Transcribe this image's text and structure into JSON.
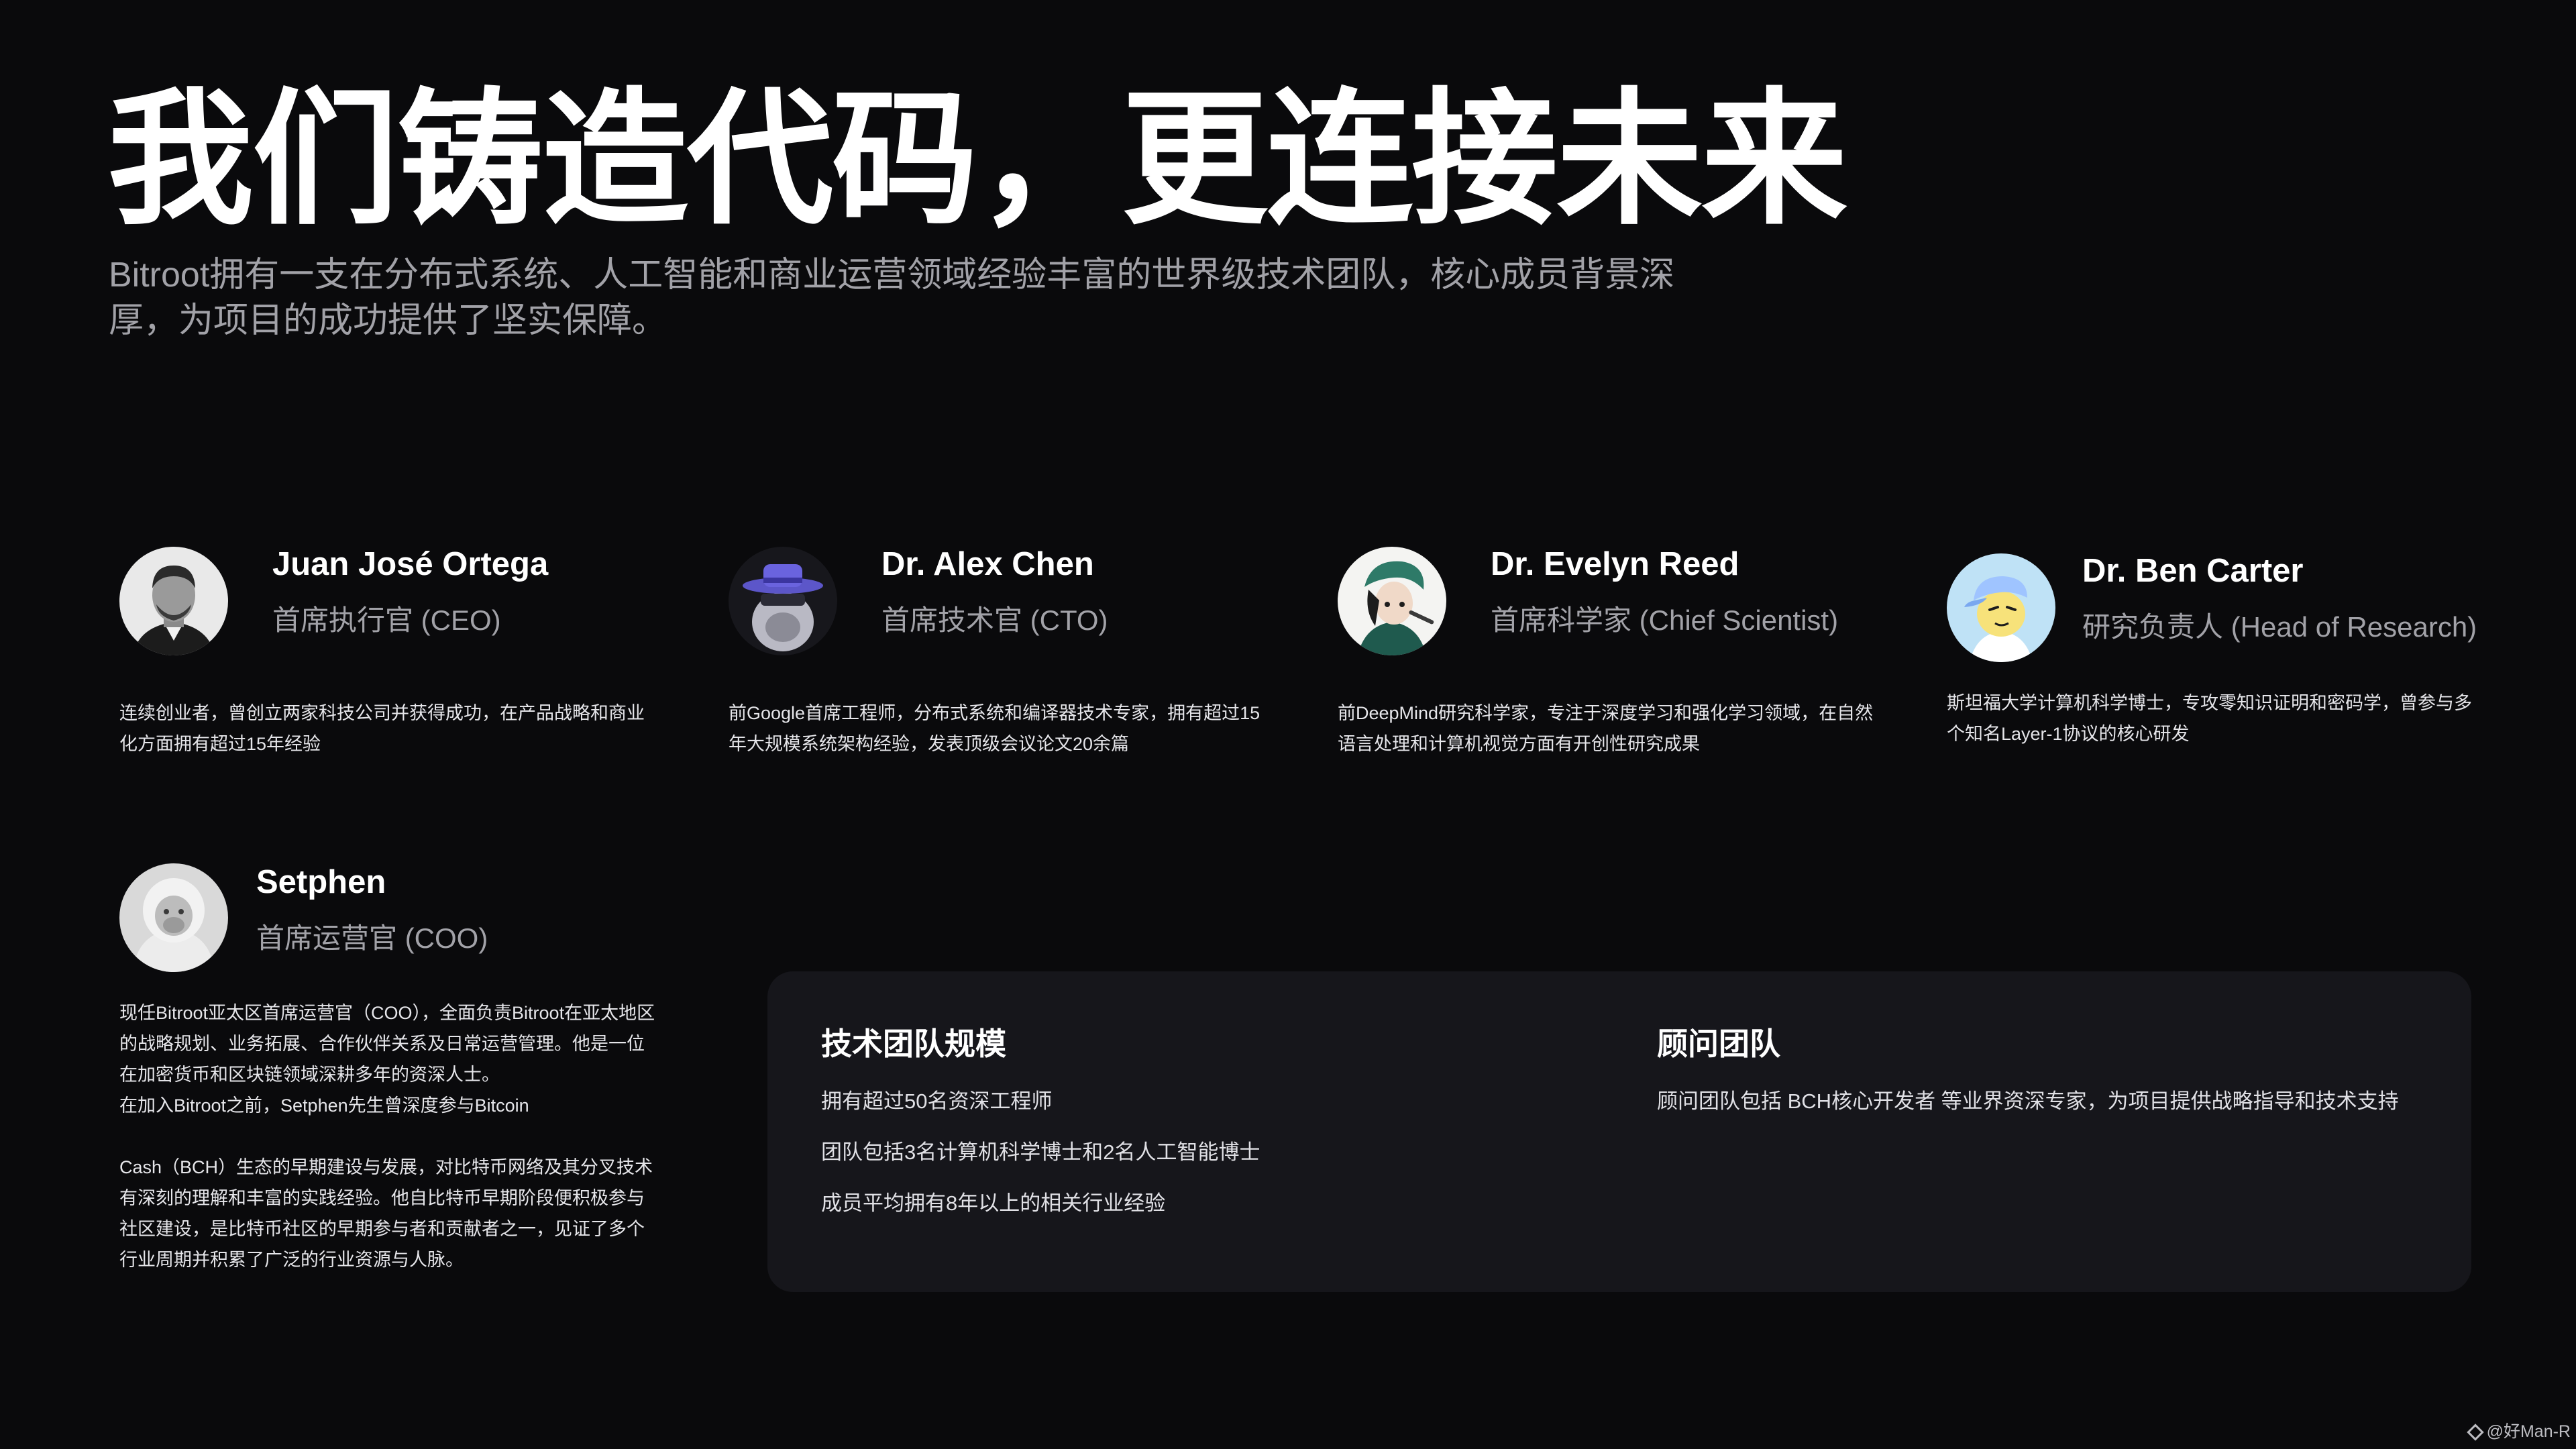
{
  "hero": {
    "title": "我们铸造代码，更连接未来",
    "subtitle": "Bitroot拥有一支在分布式系统、人工智能和商业运营领域经验丰富的世界级技术团队，核心成员背景深厚，为项目的成功提供了坚实保障。"
  },
  "team": [
    {
      "name": "Juan José Ortega",
      "role": "首席执行官 (CEO)",
      "bio": "连续创业者，曾创立两家科技公司并获得成功，在产品战略和商业化方面拥有超过15年经验",
      "avatar": "photo-portrait-man"
    },
    {
      "name": "Dr. Alex Chen",
      "role": "首席技术官 (CTO)",
      "bio": "前Google首席工程师，分布式系统和编译器技术专家，拥有超过15年大规模系统架构经验，发表顶级会议论文20余篇",
      "avatar": "nft-ape-purple-hat"
    },
    {
      "name": "Dr. Evelyn Reed",
      "role": "首席科学家 (Chief Scientist)",
      "bio": "前DeepMind研究科学家，专注于深度学习和强化学习领域，在自然语言处理和计算机视觉方面有开创性研究成果",
      "avatar": "anime-character-green-hat"
    },
    {
      "name": "Dr. Ben Carter",
      "role": "研究负责人 (Head of Research)",
      "bio": "斯坦福大学计算机科学博士，专攻零知识证明和密码学，曾参与多个知名Layer-1协议的核心研发",
      "avatar": "cartoon-blue-cap"
    },
    {
      "name": "Setphen",
      "role": "首席运营官 (COO)",
      "bio": "现任Bitroot亚太区首席运营官（COO），全面负责Bitroot在亚太地区的战略规划、业务拓展、合作伙伴关系及日常运营管理。他是一位在加密货币和区块链领域深耕多年的资深人士。\n在加入Bitroot之前，Setphen先生曾深度参与Bitcoin\n\nCash（BCH）生态的早期建设与发展，对比特币网络及其分叉技术有深刻的理解和丰富的实践经验。他自比特币早期阶段便积极参与社区建设，是比特币社区的早期参与者和贡献者之一，见证了多个行业周期并积累了广泛的行业资源与人脉。",
      "avatar": "white-ape-hoodie"
    }
  ],
  "panel": {
    "tech_team": {
      "heading": "技术团队规模",
      "items": [
        "拥有超过50名资深工程师",
        "团队包括3名计算机科学博士和2名人工智能博士",
        "成员平均拥有8年以上的相关行业经验"
      ]
    },
    "advisors": {
      "heading": "顾问团队",
      "text": "顾问团队包括 BCH核心开发者 等业界资深专家，为项目提供战略指导和技术支持"
    }
  },
  "watermark": "@好Man-R",
  "colors": {
    "background": "#0a0a0c",
    "panel": "#16161b",
    "text_primary": "#ffffff",
    "text_secondary": "#a2a2a8"
  }
}
